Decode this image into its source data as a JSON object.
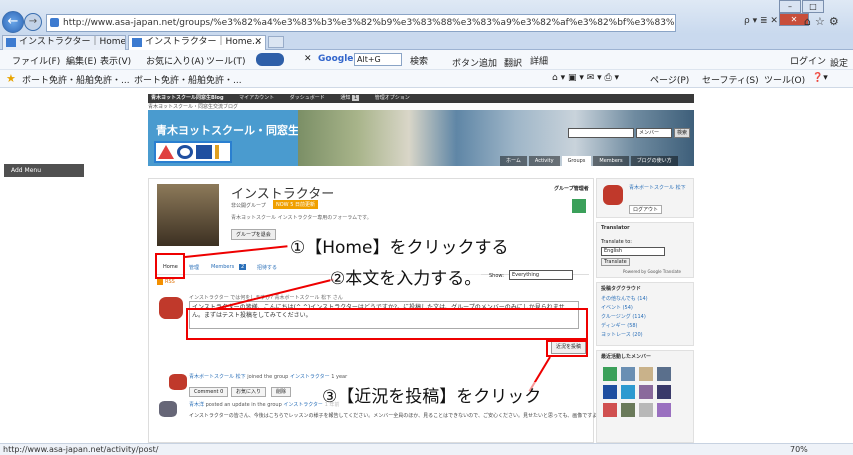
{
  "browser": {
    "url": "http://www.asa-japan.net/groups/%e3%82%a4%e3%83%b3%e3%82%b9%e3%83%88%e3%83%a9%e3%82%af%e3%82%bf%e3%83%bc/?n=1",
    "address_tools": "ρ ▾ ≣ ✕",
    "tabs": [
      {
        "label": "インストラクター｜Home｜..."
      },
      {
        "label": "インストラクター｜Home..."
      }
    ],
    "menu": [
      "ファイル(F)",
      "編集(E)",
      "表示(V)",
      "お気に入り(A)",
      "ツール(T)"
    ],
    "toolbar": {
      "google": "Google",
      "search_field": "Alt+G",
      "search_label": "検索",
      "add_button": "ボタン追加",
      "translate": "翻訳",
      "detail": "詳細",
      "login": "ログイン",
      "settings": "設定"
    },
    "favorites": [
      "ボート免許・船舶免許・...",
      "ボート免許・船舶免許・..."
    ],
    "command_bar": [
      "ページ(P)",
      "セーフティ(S)",
      "ツール(O)"
    ],
    "status_url": "http://www.asa-japan.net/activity/post/",
    "zoom": "70%"
  },
  "page": {
    "left_panel": "Add Menu",
    "admin_bar": [
      "青木ヨットスクール同窓生Blog",
      "マイアカウント",
      "ダッシュボード",
      "通知",
      "管理オプション"
    ],
    "admin_notice_count": "1",
    "site_sub": "青木ヨットスクール・同窓生交流ブログ",
    "banner_title": "青木ヨットスクール・同窓生Blog",
    "banner_nav": [
      "ホーム",
      "Activity",
      "Groups",
      "Members",
      "ブログの使い方"
    ],
    "search_select": "メンバー",
    "search_button": "検索",
    "group": {
      "title": "インストラクター",
      "type": "非公開グループ",
      "badge": "NOW 5 日前更新",
      "description": "青木ヨットスクール インストラクター専用のフォーラムです。",
      "leave_button": "グループを退会",
      "admins_label": "グループ管理者"
    },
    "subnav": [
      "Home",
      "管理",
      "Members",
      "2",
      "招待する"
    ],
    "show_label": "Show:",
    "show_value": "Everything",
    "rss": "RSS",
    "post_prompt": "インストラクター では何をしますか? 青木ボートスクール 松下 さん",
    "post_text": "インストラクターの皆様、こんにちは(^ ^)インストラクターはどうですか?。に投稿した文は、グループのメンバーのみにしか見られません。まずはテスト投稿をしてみてください。",
    "post_button": "近況を投稿",
    "activity1": {
      "author": "青木ボートスクール 松下",
      "action": "joined the group",
      "group": "インストラクター",
      "time": "1 year",
      "buttons": [
        "Comment 0",
        "お気に入り",
        "削除"
      ]
    },
    "activity2": {
      "author": "青木洋",
      "action": "posted an update in the group",
      "group": "インストラクター",
      "time": "1 年前",
      "text": "インストラクターの皆さん、今後はこちらでレッスンの様子を報告してください。メンバー全員のほか、見ることはできないので、ご安心ください。見せたいと思っても、画像ですよ。ヨット"
    },
    "right": {
      "profile_name": "青木ボートスクール 松下",
      "logout": "ログアウト",
      "translator_head": "Translator",
      "translate_to": "Translate to:",
      "language": "English",
      "translate_button": "Translate",
      "powered": "Powered by Google Translate",
      "tags_head": "投稿タグクラウド",
      "tags": [
        "その他なんでも (14)",
        "イベント (54)",
        "クルージング (114)",
        "ディンギー (58)",
        "ヨットレース (20)"
      ],
      "members_head": "最近活動したメンバー"
    }
  },
  "annotations": {
    "step1": "①【Home】をクリックする",
    "step2": "②本文を入力する。",
    "step3": "③【近況を投稿】をクリック"
  }
}
